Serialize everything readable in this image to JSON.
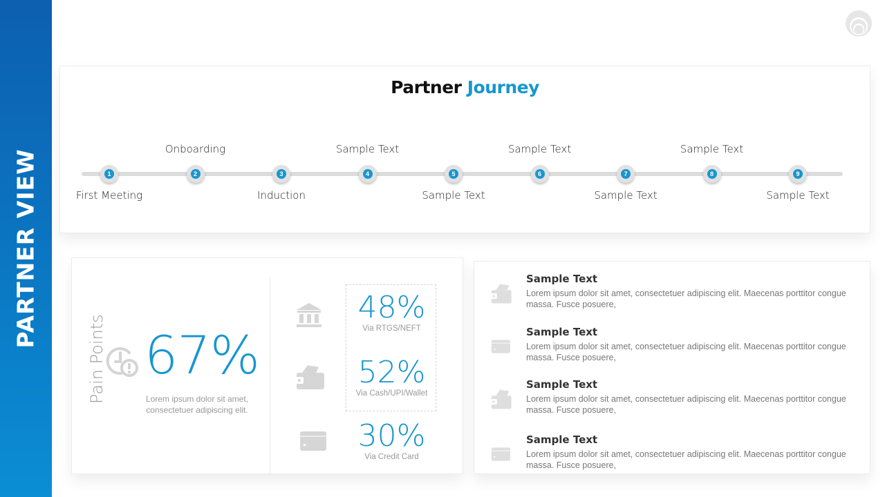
{
  "sidebar": {
    "title": "PARTNER VIEW"
  },
  "journey": {
    "title_part1": "Partner",
    "title_part2": "Journey",
    "steps": [
      {
        "number": "1",
        "label": "First Meeting",
        "position": "bottom"
      },
      {
        "number": "2",
        "label": "Onboarding",
        "position": "top"
      },
      {
        "number": "3",
        "label": "Induction",
        "position": "bottom"
      },
      {
        "number": "4",
        "label": "Sample Text",
        "position": "top"
      },
      {
        "number": "5",
        "label": "Sample Text",
        "position": "bottom"
      },
      {
        "number": "6",
        "label": "Sample Text",
        "position": "top"
      },
      {
        "number": "7",
        "label": "Sample Text",
        "position": "bottom"
      },
      {
        "number": "8",
        "label": "Sample Text",
        "position": "top"
      },
      {
        "number": "9",
        "label": "Sample Text",
        "position": "bottom"
      }
    ]
  },
  "pain_points": {
    "title": "Pain Points",
    "percent": "67%",
    "description_line1": "Lorem ipsum dolor sit amet,",
    "description_line2": "consectetuer adipiscing elit.",
    "stats": [
      {
        "icon": "bank-icon",
        "percent": "48%",
        "label": "Via RTGS/NEFT"
      },
      {
        "icon": "wallet-icon",
        "percent": "52%",
        "label": "Via Cash/UPI/Wallet"
      },
      {
        "icon": "credit-card-icon",
        "percent": "30%",
        "label": "Via Credit Card"
      }
    ]
  },
  "details": {
    "items": [
      {
        "icon": "wallet-icon",
        "title": "Sample Text",
        "body": "Lorem ipsum dolor sit amet, consectetuer adipiscing elit. Maecenas porttitor congue massa. Fusce posuere,"
      },
      {
        "icon": "credit-card-icon",
        "title": "Sample Text",
        "body": "Lorem ipsum dolor sit amet, consectetuer adipiscing elit. Maecenas porttitor congue massa. Fusce posuere,"
      },
      {
        "icon": "wallet-icon",
        "title": "Sample Text",
        "body": "Lorem ipsum dolor sit amet, consectetuer adipiscing elit. Maecenas porttitor congue massa. Fusce posuere,"
      },
      {
        "icon": "credit-card-icon",
        "title": "Sample Text",
        "body": "Lorem ipsum dolor sit amet, consectetuer adipiscing elit. Maecenas porttitor congue massa. Fusce posuere,"
      }
    ]
  },
  "colors": {
    "accent": "#1896cf",
    "sidebar_top": "#0d5fb0",
    "sidebar_bottom": "#0b8ed4",
    "icon_gray": "#d6d6d6"
  }
}
